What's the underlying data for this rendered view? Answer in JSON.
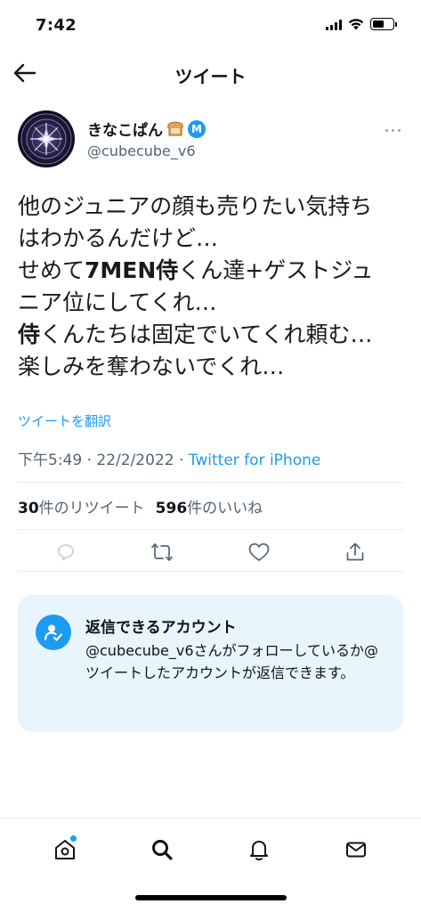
{
  "status_bar": {
    "time": "7:42"
  },
  "header": {
    "title": "ツイート"
  },
  "author": {
    "name": "きなこぱん",
    "badge_letter": "M",
    "handle": "@cubecube_v6"
  },
  "tweet": {
    "line1": "他のジュニアの顔も売りたい気持ち",
    "line2": "はわかるんだけど…",
    "line3_pre": "せめて",
    "line3_bold": "7MEN侍",
    "line3_post": "くん達+ゲストジュ",
    "line4": "ニア位にしてくれ…",
    "line5_bold": "侍",
    "line5_post": "くんたちは固定でいてくれ頼む…",
    "line6": "楽しみを奪わないでくれ…"
  },
  "translate_label": "ツイートを翻訳",
  "meta": {
    "time": "下午5:49",
    "separator": "·",
    "date": "22/2/2022",
    "source": "Twitter for iPhone"
  },
  "stats": {
    "retweets_count": "30",
    "retweets_label": "件のリツイート",
    "likes_count": "596",
    "likes_label": "件のいいね"
  },
  "reply_card": {
    "title": "返信できるアカウント",
    "description": "@cubecube_v6さんがフォローしているか@ツイートしたアカウントが返信できます。"
  },
  "colors": {
    "accent": "#1d9bf0",
    "secondary_text": "#536471",
    "card_bg": "#e8f5fd"
  },
  "icons": {
    "back": "arrow-left-icon",
    "more": "more-dots-icon",
    "reply": "reply-icon",
    "retweet": "retweet-icon",
    "like": "heart-icon",
    "share": "share-icon",
    "home": "home-icon",
    "search": "search-icon",
    "notifications": "bell-icon",
    "messages": "mail-icon"
  }
}
